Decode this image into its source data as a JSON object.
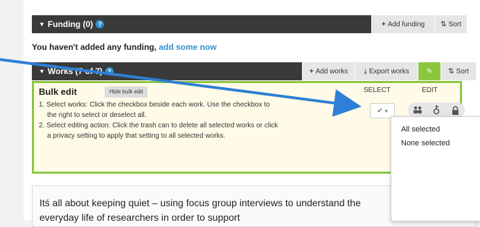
{
  "funding": {
    "title": "Funding (0)",
    "add_label": "Add funding",
    "sort_label": "Sort",
    "empty_text": "You haven't added any funding,",
    "empty_link": "add some now"
  },
  "works": {
    "title": "Works (7 of 7)",
    "add_label": "Add works",
    "export_label": "Export works",
    "bulk_label": "Bulk edit",
    "sort_label": "Sort"
  },
  "bulk_edit": {
    "title": "Bulk edit",
    "hide_label": "Hide bulk edit",
    "select_heading": "SELECT",
    "edit_heading": "EDIT",
    "steps": [
      "1. Select works: Click the checkbox beside each work. Use the checkbox to the right to select or deselect all.",
      "2. Select editing action: Click the trash can to delete all selected works or click a privacy setting to apply that setting to all selected works."
    ]
  },
  "dropdown": {
    "items": [
      "All selected",
      "None selected"
    ]
  },
  "work": {
    "title": "Itś all about keeping quiet – using focus group interviews to understand the everyday life of researchers in order to support"
  },
  "colors": {
    "bar_dark": "#3a3a3a",
    "accent_green": "#8cc63f",
    "link_blue": "#2e8fd0"
  }
}
